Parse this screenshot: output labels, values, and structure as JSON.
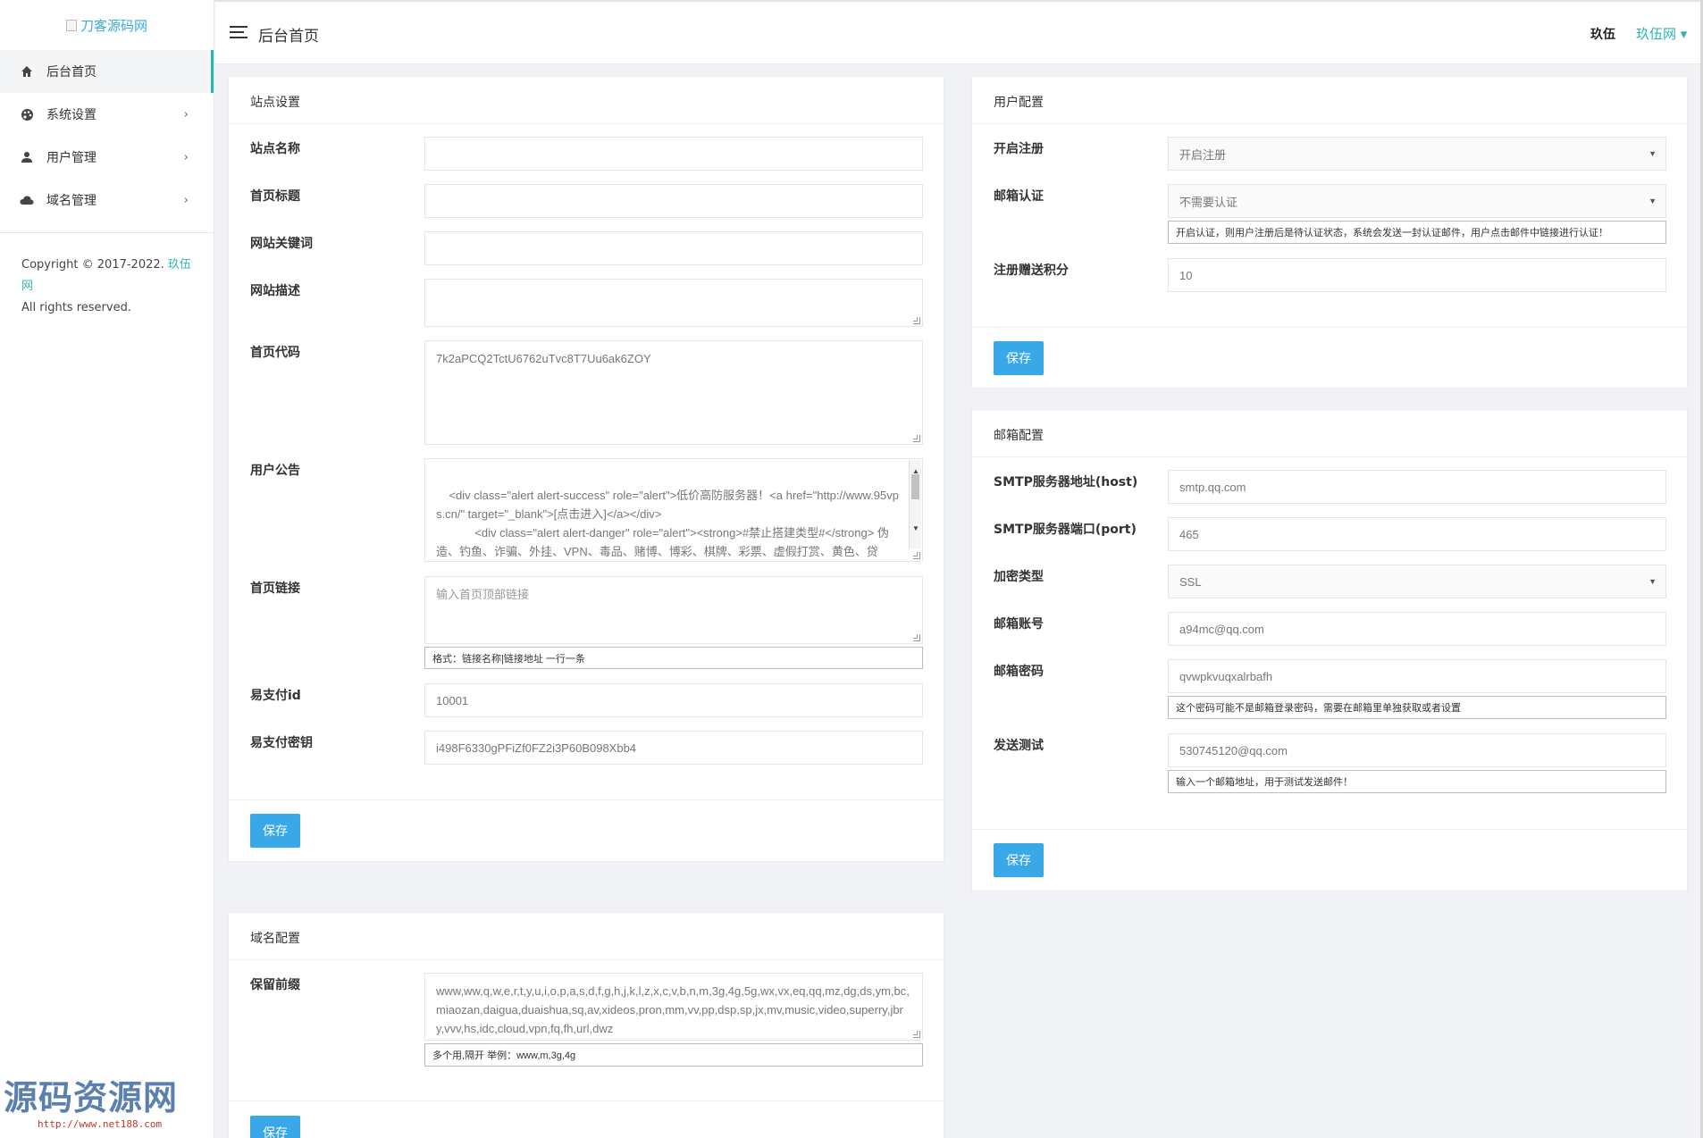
{
  "sidebar": {
    "logo_alt": "刀客源码网",
    "items": [
      {
        "label": "后台首页",
        "icon": "home-icon",
        "active": true
      },
      {
        "label": "系统设置",
        "icon": "palette-icon"
      },
      {
        "label": "用户管理",
        "icon": "user-icon"
      },
      {
        "label": "域名管理",
        "icon": "cloud-icon"
      }
    ],
    "copyright_prefix": "Copyright © 2017-2022.",
    "copyright_link": "玖伍网",
    "copyright_suffix": "All rights reserved."
  },
  "watermark": {
    "text": "源码资源网",
    "url": "http://www.net188.com"
  },
  "header": {
    "title": "后台首页",
    "user": "玖伍",
    "site": "玖伍网 ▾"
  },
  "site_settings": {
    "title": "站点设置",
    "fields": {
      "site_name": {
        "label": "站点名称",
        "value": ""
      },
      "home_title": {
        "label": "首页标题",
        "value": ""
      },
      "keywords": {
        "label": "网站关键词",
        "value": ""
      },
      "description": {
        "label": "网站描述",
        "value": ""
      },
      "home_code": {
        "label": "首页代码",
        "value": "7k2aPCQ2TctU6762uTvc8T7Uu6ak6ZOY"
      },
      "notice": {
        "label": "用户公告",
        "value": "<div class=\"alert alert-success\" role=\"alert\">低价高防服务器！<a href=\"http://www.95vps.cn/\" target=\"_blank\">[点击进入]</a></div>\n            <div class=\"alert alert-danger\" role=\"alert\"><strong>#禁止搭建类型#</strong> 伪造、钓鱼、诈骗、外挂、VPN、毒品、赌博、博彩、棋牌、彩票、虚假打赏、黄色、贷款、色情交友、盗版影视、不正常言论、不合法的信息收集、圈"
      },
      "home_links": {
        "label": "首页链接",
        "placeholder": "输入首页顶部链接",
        "hint": "格式：链接名称|链接地址 一行一条"
      },
      "pay_id": {
        "label": "易支付id",
        "value": "10001"
      },
      "pay_key": {
        "label": "易支付密钥",
        "value": "i498F6330gPFiZf0FZ2i3P60B098Xbb4"
      }
    },
    "save": "保存"
  },
  "domain_config": {
    "title": "域名配置",
    "reserved": {
      "label": "保留前缀",
      "value": "www,ww,q,w,e,r,t,y,u,i,o,p,a,s,d,f,g,h,j,k,l,z,x,c,v,b,n,m,3g,4g,5g,wx,vx,eq,qq,mz,dg,ds,ym,bc,miaozan,daigua,duaishua,sq,av,xideos,pron,mm,vv,pp,dsp,sp,jx,mv,music,video,superry,jbry,vvv,hs,idc,cloud,vpn,fq,fh,url,dwz",
      "hint": "多个用,隔开 举例：www,m,3g,4g"
    },
    "save": "保存"
  },
  "user_config": {
    "title": "用户配置",
    "register": {
      "label": "开启注册",
      "value": "开启注册"
    },
    "email_verify": {
      "label": "邮箱认证",
      "value": "不需要认证",
      "hint": "开启认证，则用户注册后是待认证状态，系统会发送一封认证邮件，用户点击邮件中链接进行认证！"
    },
    "points": {
      "label": "注册赠送积分",
      "value": "10"
    },
    "save": "保存"
  },
  "mail_config": {
    "title": "邮箱配置",
    "host": {
      "label": "SMTP服务器地址(host)",
      "value": "smtp.qq.com"
    },
    "port": {
      "label": "SMTP服务器端口(port)",
      "value": "465"
    },
    "encryption": {
      "label": "加密类型",
      "value": "SSL"
    },
    "account": {
      "label": "邮箱账号",
      "value": "a94mc@qq.com"
    },
    "password": {
      "label": "邮箱密码",
      "value": "qvwpkvuqxalrbafh",
      "hint": "这个密码可能不是邮箱登录密码，需要在邮箱里单独获取或者设置"
    },
    "test": {
      "label": "发送测试",
      "value": "530745120@qq.com",
      "hint": "输入一个邮箱地址，用于测试发送邮件！"
    },
    "save": "保存"
  }
}
